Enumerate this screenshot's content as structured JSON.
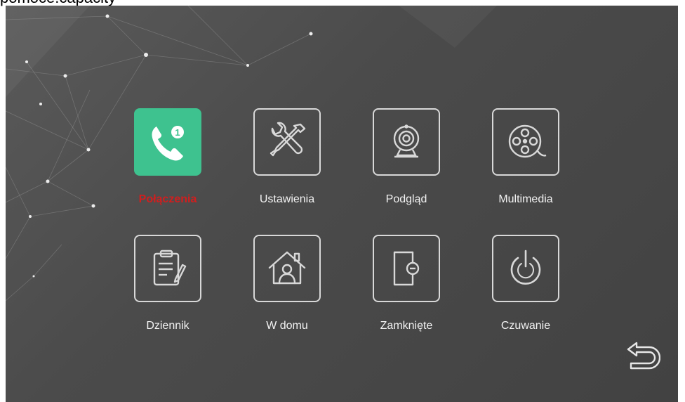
{
  "page": {
    "top_cut_text": "pomoce.capacity"
  },
  "menu": {
    "items": [
      {
        "id": "calls",
        "label": "Połączenia",
        "icon": "phone-call-icon",
        "badge": "1",
        "active": true
      },
      {
        "id": "settings",
        "label": "Ustawienia",
        "icon": "tools-icon",
        "active": false
      },
      {
        "id": "preview",
        "label": "Podgląd",
        "icon": "webcam-icon",
        "active": false
      },
      {
        "id": "multimedia",
        "label": "Multimedia",
        "icon": "film-reel-icon",
        "active": false
      },
      {
        "id": "log",
        "label": "Dziennik",
        "icon": "clipboard-icon",
        "active": false
      },
      {
        "id": "home",
        "label": "W domu",
        "icon": "home-user-icon",
        "active": false
      },
      {
        "id": "locked",
        "label": "Zamknięte",
        "icon": "door-lock-icon",
        "active": false
      },
      {
        "id": "standby",
        "label": "Czuwanie",
        "icon": "power-icon",
        "active": false
      }
    ]
  },
  "controls": {
    "back_icon": "return-arrow-icon"
  },
  "colors": {
    "active_tile": "#3ec28f",
    "active_label": "#d11e1e",
    "icon_stroke": "#d8d8d8",
    "background": "#4b4b4b"
  }
}
